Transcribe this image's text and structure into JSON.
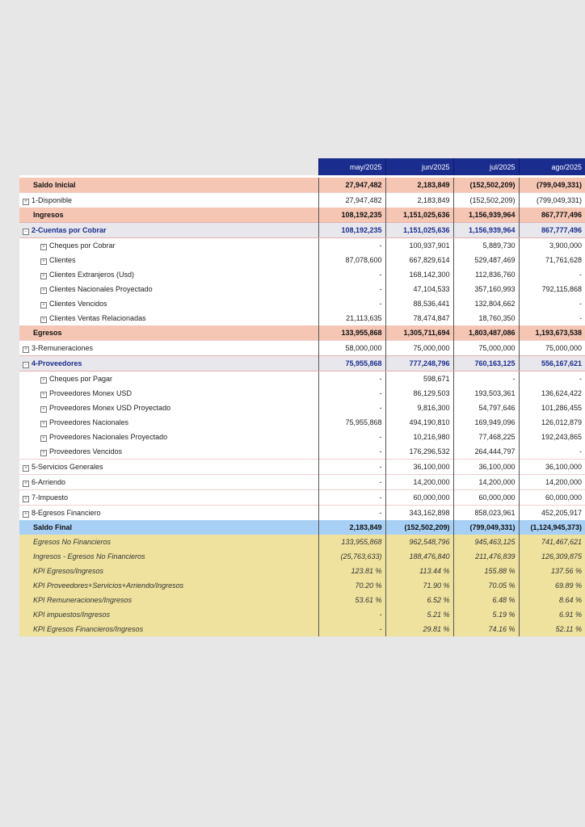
{
  "table": {
    "headers": [
      "may/2025",
      "jun/2025",
      "jul/2025",
      "ago/2025"
    ],
    "rows": [
      {
        "style": "salmon",
        "label": "Saldo Inicial",
        "values": [
          "27,947,482",
          "2,183,849",
          "(152,502,209)",
          "(799,049,331)"
        ]
      },
      {
        "style": "level1",
        "icon": "expand-plus-icon",
        "icon_glyph": "+",
        "label": "1-Disponible",
        "values": [
          "27,947,482",
          "2,183,849",
          "(152,502,209)",
          "(799,049,331)"
        ]
      },
      {
        "style": "salmon",
        "label": "Ingresos",
        "values": [
          "108,192,235",
          "1,151,025,636",
          "1,156,939,964",
          "867,777,496"
        ]
      },
      {
        "style": "blue",
        "icon": "collapse-minus-icon",
        "icon_glyph": "−",
        "label": "2-Cuentas por Cobrar",
        "values": [
          "108,192,235",
          "1,151,025,636",
          "1,156,939,964",
          "867,777,496"
        ]
      },
      {
        "style": "child",
        "icon": "expand-plus-icon",
        "icon_glyph": "+",
        "label": "Cheques por Cobrar",
        "values": [
          "-",
          "100,937,901",
          "5,889,730",
          "3,900,000"
        ]
      },
      {
        "style": "child",
        "icon": "expand-plus-icon",
        "icon_glyph": "+",
        "label": "Clientes",
        "values": [
          "87,078,600",
          "667,829,614",
          "529,487,469",
          "71,761,628"
        ]
      },
      {
        "style": "child",
        "icon": "expand-plus-icon",
        "icon_glyph": "+",
        "label": "Clientes Extranjeros (Usd)",
        "values": [
          "-",
          "168,142,300",
          "112,836,760",
          "-"
        ]
      },
      {
        "style": "child",
        "icon": "expand-plus-icon",
        "icon_glyph": "+",
        "label": "Clientes Nacionales Proyectado",
        "values": [
          "-",
          "47,104,533",
          "357,160,993",
          "792,115,868"
        ]
      },
      {
        "style": "child",
        "icon": "expand-plus-icon",
        "icon_glyph": "+",
        "label": "Clientes Vencidos",
        "values": [
          "-",
          "88,536,441",
          "132,804,662",
          "-"
        ]
      },
      {
        "style": "child",
        "icon": "expand-plus-icon",
        "icon_glyph": "+",
        "label": "Clientes Ventas Relacionadas",
        "values": [
          "21,113,635",
          "78,474,847",
          "18,760,350",
          "-"
        ]
      },
      {
        "style": "salmon",
        "label": "Egresos",
        "values": [
          "133,955,868",
          "1,305,711,694",
          "1,803,487,086",
          "1,193,673,538"
        ]
      },
      {
        "style": "level1",
        "icon": "expand-plus-icon",
        "icon_glyph": "+",
        "label": "3-Remuneraciones",
        "values": [
          "58,000,000",
          "75,000,000",
          "75,000,000",
          "75,000,000"
        ]
      },
      {
        "style": "blue",
        "icon": "collapse-minus-icon",
        "icon_glyph": "−",
        "label": "4-Proveedores",
        "values": [
          "75,955,868",
          "777,248,796",
          "760,163,125",
          "556,167,621"
        ]
      },
      {
        "style": "child",
        "icon": "expand-plus-icon",
        "icon_glyph": "+",
        "label": "Cheques por Pagar",
        "values": [
          "-",
          "598,671",
          "-",
          "-"
        ]
      },
      {
        "style": "child",
        "icon": "expand-plus-icon",
        "icon_glyph": "+",
        "label": "Proveedores Monex USD",
        "values": [
          "-",
          "86,129,503",
          "193,503,361",
          "136,624,422"
        ]
      },
      {
        "style": "child",
        "icon": "expand-plus-icon",
        "icon_glyph": "+",
        "label": "Proveedores Monex USD Proyectado",
        "values": [
          "-",
          "9,816,300",
          "54,797,646",
          "101,286,455"
        ]
      },
      {
        "style": "child",
        "icon": "expand-plus-icon",
        "icon_glyph": "+",
        "label": "Proveedores Nacionales",
        "values": [
          "75,955,868",
          "494,190,810",
          "169,949,096",
          "126,012,879"
        ]
      },
      {
        "style": "child",
        "icon": "expand-plus-icon",
        "icon_glyph": "+",
        "label": "Proveedores Nacionales Proyectado",
        "values": [
          "-",
          "10,216,980",
          "77,468,225",
          "192,243,865"
        ]
      },
      {
        "style": "child",
        "icon": "expand-plus-icon",
        "icon_glyph": "+",
        "label": "Proveedores Vencidos",
        "values": [
          "-",
          "176,296,532",
          "264,444,797",
          "-"
        ]
      },
      {
        "style": "level1",
        "icon": "expand-plus-icon",
        "icon_glyph": "+",
        "label": "5-Servicios Generales",
        "values": [
          "-",
          "36,100,000",
          "36,100,000",
          "36,100,000"
        ]
      },
      {
        "style": "level1",
        "icon": "expand-plus-icon",
        "icon_glyph": "+",
        "label": "6-Arriendo",
        "values": [
          "-",
          "14,200,000",
          "14,200,000",
          "14,200,000"
        ]
      },
      {
        "style": "level1",
        "icon": "expand-plus-icon",
        "icon_glyph": "+",
        "label": "7-Impuesto",
        "values": [
          "-",
          "60,000,000",
          "60,000,000",
          "60,000,000"
        ]
      },
      {
        "style": "level1",
        "icon": "expand-plus-icon",
        "icon_glyph": "+",
        "label": "8-Egresos Financiero",
        "values": [
          "-",
          "343,162,898",
          "858,023,961",
          "452,205,917"
        ]
      },
      {
        "style": "final",
        "label": "Saldo Final",
        "values": [
          "2,183,849",
          "(152,502,209)",
          "(799,049,331)",
          "(1,124,945,373)"
        ]
      },
      {
        "style": "kpi",
        "label": "Egresos No Financieros",
        "values": [
          "133,955,868",
          "962,548,796",
          "945,463,125",
          "741,467,621"
        ]
      },
      {
        "style": "kpi",
        "label": "Ingresos - Egresos No Financieros",
        "values": [
          "(25,763,633)",
          "188,476,840",
          "211,476,839",
          "126,309,875"
        ]
      },
      {
        "style": "kpi",
        "label": "KPI Egresos/Ingresos",
        "values": [
          "123.81 %",
          "113.44 %",
          "155.88 %",
          "137.56 %"
        ]
      },
      {
        "style": "kpi",
        "label": "KPI Proveedores+Servicios+Arriendo/Ingresos",
        "values": [
          "70.20 %",
          "71.90 %",
          "70.05 %",
          "69.89 %"
        ]
      },
      {
        "style": "kpi",
        "label": "KPI Remuneraciones/Ingresos",
        "values": [
          "53.61 %",
          "6.52 %",
          "6.48 %",
          "8.64 %"
        ]
      },
      {
        "style": "kpi",
        "label": "KPI impuestos/Ingresos",
        "values": [
          "-",
          "5.21 %",
          "5.19 %",
          "6.91 %"
        ]
      },
      {
        "style": "kpi",
        "label": "KPI Egresos Financieros/Ingresos",
        "values": [
          "-",
          "29.81 %",
          "74.16 %",
          "52.11 %"
        ]
      }
    ]
  }
}
